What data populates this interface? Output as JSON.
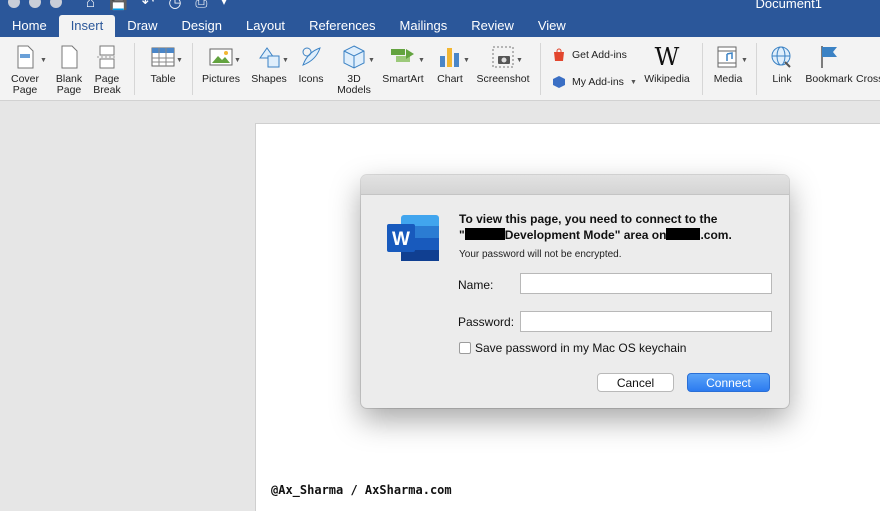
{
  "window": {
    "title": "Document1",
    "qat_icons": [
      "home-icon",
      "save-icon",
      "undo-icon",
      "clock-icon",
      "print-icon",
      "more-icon"
    ]
  },
  "tabs": [
    {
      "label": "Home"
    },
    {
      "label": "Insert",
      "active": true
    },
    {
      "label": "Draw"
    },
    {
      "label": "Design"
    },
    {
      "label": "Layout"
    },
    {
      "label": "References"
    },
    {
      "label": "Mailings"
    },
    {
      "label": "Review"
    },
    {
      "label": "View"
    }
  ],
  "ribbon": {
    "cover_page": "Cover\nPage",
    "blank_page": "Blank\nPage",
    "page_break": "Page\nBreak",
    "table": "Table",
    "pictures": "Pictures",
    "shapes": "Shapes",
    "icons": "Icons",
    "models_3d": "3D\nModels",
    "smartart": "SmartArt",
    "chart": "Chart",
    "screenshot": "Screenshot",
    "get_addins": "Get Add-ins",
    "my_addins": "My Add-ins",
    "wikipedia": "Wikipedia",
    "wiki_glyph": "W",
    "media": "Media",
    "link": "Link",
    "bookmark": "Bookmark",
    "cross_ref": "Cross"
  },
  "dialog": {
    "title_line1": "To view this page, you need to connect to the",
    "title_q_open": "\"",
    "title_line2_a": "Development Mode\" area on",
    "title_line2_b": ".com.",
    "subtitle": "Your password will not be encrypted.",
    "name_label": "Name:",
    "name_value": "",
    "password_label": "Password:",
    "password_value": "",
    "keychain_label": "Save password in my Mac OS keychain",
    "keychain_checked": false,
    "cancel_label": "Cancel",
    "connect_label": "Connect",
    "app_letter": "W"
  },
  "document": {
    "watermark": "@Ax_Sharma / AxSharma.com"
  },
  "colors": {
    "word_blue": "#2b579a",
    "connect_blue": "#2c7bf0"
  }
}
